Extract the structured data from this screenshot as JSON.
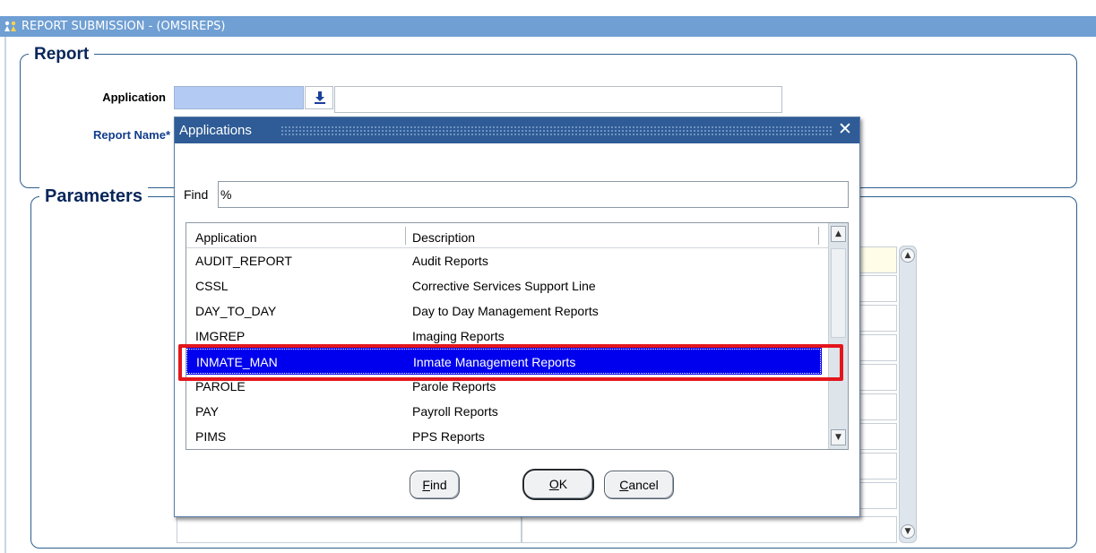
{
  "window": {
    "title": "REPORT SUBMISSION - (OMSIREPS)",
    "title_bar_color": "#6f9fd3"
  },
  "report_frame": {
    "title": "Report",
    "application_label": "Application",
    "application_value": "",
    "application_description": "",
    "report_name_label": "Report Name*"
  },
  "parameters_frame": {
    "title": "Parameters"
  },
  "dialog": {
    "title": "Applications",
    "close_icon": "close-icon",
    "find_label": "Find",
    "find_value": "%",
    "columns": [
      "Application",
      "Description"
    ],
    "rows": [
      {
        "application": "AUDIT_REPORT",
        "description": "Audit Reports"
      },
      {
        "application": "CSSL",
        "description": "Corrective Services Support Line"
      },
      {
        "application": "DAY_TO_DAY",
        "description": "Day to Day Management Reports"
      },
      {
        "application": "IMGREP",
        "description": "Imaging Reports"
      },
      {
        "application": "INMATE_MAN",
        "description": "Inmate Management Reports"
      },
      {
        "application": "PAROLE",
        "description": "Parole Reports"
      },
      {
        "application": "PAY",
        "description": "Payroll Reports"
      },
      {
        "application": "PIMS",
        "description": "PPS Reports"
      }
    ],
    "selected_index": 4,
    "buttons": {
      "find": {
        "prefix": "",
        "mnemonic": "F",
        "rest": "ind"
      },
      "ok": {
        "prefix": "",
        "mnemonic": "O",
        "rest": "K"
      },
      "cancel": {
        "prefix": "",
        "mnemonic": "C",
        "rest": "ancel"
      }
    },
    "selection_color": "#0000ee",
    "highlight_color": "#e3161c"
  }
}
